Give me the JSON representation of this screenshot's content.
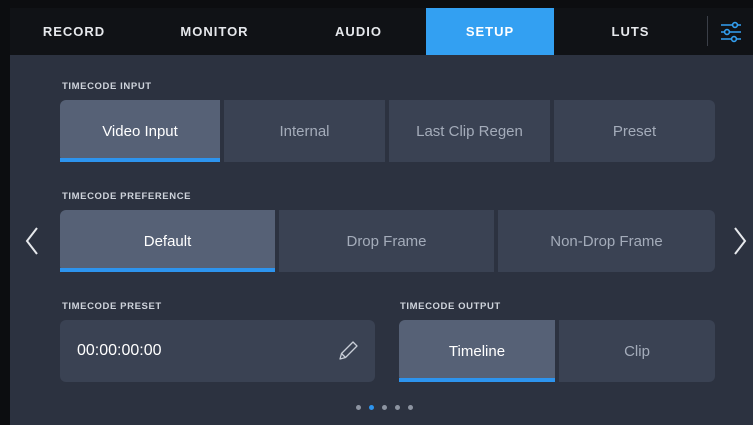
{
  "nav": {
    "tabs": [
      {
        "label": "RECORD",
        "active": false
      },
      {
        "label": "MONITOR",
        "active": false
      },
      {
        "label": "AUDIO",
        "active": false
      },
      {
        "label": "SETUP",
        "active": true
      },
      {
        "label": "LUTS",
        "active": false
      }
    ],
    "menu_icon": "sliders-icon"
  },
  "timecode_input": {
    "label": "TIMECODE INPUT",
    "options": [
      "Video Input",
      "Internal",
      "Last Clip Regen",
      "Preset"
    ],
    "selected": "Video Input"
  },
  "timecode_preference": {
    "label": "TIMECODE PREFERENCE",
    "options": [
      "Default",
      "Drop Frame",
      "Non-Drop Frame"
    ],
    "selected": "Default"
  },
  "timecode_preset": {
    "label": "TIMECODE PRESET",
    "value": "00:00:00:00",
    "edit_icon": "pencil-icon"
  },
  "timecode_output": {
    "label": "TIMECODE OUTPUT",
    "options": [
      "Timeline",
      "Clip"
    ],
    "selected": "Timeline"
  },
  "pagination": {
    "pages": 5,
    "current": 2
  },
  "navigation": {
    "prev_icon": "chevron-left-icon",
    "next_icon": "chevron-right-icon"
  },
  "colors": {
    "accent": "#33a0f2",
    "background": "#2c3240",
    "button": "#3a4253",
    "button_active": "#566176"
  }
}
